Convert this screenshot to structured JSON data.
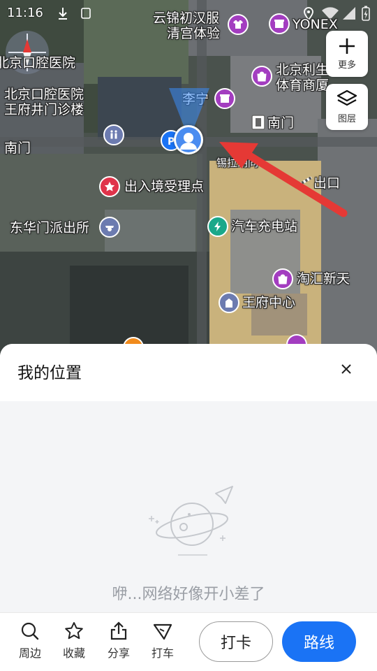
{
  "status_bar": {
    "time": "11:16"
  },
  "map": {
    "pois": [
      {
        "label": "云锦初汉服",
        "color": "#a33dc0"
      },
      {
        "label": "清宫体验",
        "color": "#a33dc0"
      },
      {
        "label": "YONEX",
        "color": "#a33dc0"
      },
      {
        "label": "北京口腔医院",
        "color": ""
      },
      {
        "label": "北京利生",
        "color": "#a33dc0"
      },
      {
        "label": "体育商厦",
        "color": ""
      },
      {
        "label": "北京口腔医院",
        "color": ""
      },
      {
        "label": "王府井门诊楼",
        "color": ""
      },
      {
        "label": "李宁",
        "color": "#a33dc0"
      },
      {
        "label": "南门",
        "color": "#ffffff"
      },
      {
        "label": "南门",
        "color": ""
      },
      {
        "label": "锡拉胡同",
        "color": ""
      },
      {
        "label": "出口",
        "color": "#ffffff"
      },
      {
        "label": "出入境受理点",
        "color": "#e0334a"
      },
      {
        "label": "东华门派出所",
        "color": "#6c7bb0"
      },
      {
        "label": "汽车充电站",
        "color": "#1aa88a"
      },
      {
        "label": "淘汇新天",
        "color": "#a33dc0"
      },
      {
        "label": "王府中心",
        "color": "#6c7bb0"
      }
    ],
    "controls": {
      "more_label": "更多",
      "layers_label": "图层"
    }
  },
  "sheet": {
    "title": "我的位置",
    "empty_message": "咿...网络好像开小差了"
  },
  "actions": {
    "nearby": "周边",
    "favorite": "收藏",
    "share": "分享",
    "taxi": "打车",
    "checkin": "打卡",
    "route": "路线"
  },
  "colors": {
    "route_button": "#1a73f5",
    "arrow": "#e53935"
  }
}
